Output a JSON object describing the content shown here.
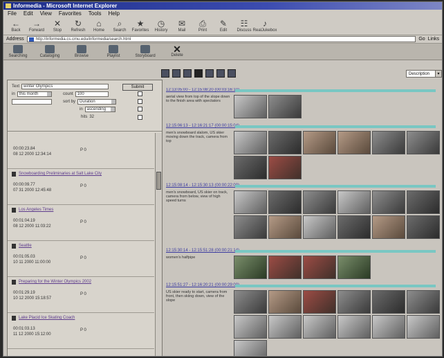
{
  "window": {
    "title": "Informedia - Microsoft Internet Explorer"
  },
  "menu": [
    "File",
    "Edit",
    "View",
    "Favorites",
    "Tools",
    "Help"
  ],
  "toolbar": [
    "Back",
    "Forward",
    "Stop",
    "Refresh",
    "Home",
    "Search",
    "Favorites",
    "History",
    "Mail",
    "Print",
    "Edit",
    "Discuss",
    "RealJukebox"
  ],
  "address": {
    "label": "Address",
    "url": "http://informedia.cs.cmu.edu/informedia/search.html",
    "go": "Go",
    "links": "Links"
  },
  "apptools": [
    "Searching",
    "Cataloging",
    "Browse",
    "Playlist",
    "Storyboard",
    "Delete"
  ],
  "view": {
    "mode": "Description"
  },
  "search": {
    "text_label": "Text",
    "text_value": "winter Olympics",
    "submit": "Submit",
    "in_label": "in",
    "in_value": "this month",
    "count_label": "count",
    "count_value": "100",
    "sort_label": "sort by",
    "sort_value": "Duration",
    "order_label": "in",
    "order_value": "ascending",
    "results_label": "hits",
    "results_value": "32"
  },
  "results": [
    {
      "title": "",
      "d1": "00:00:23.84",
      "d2": "08 12 2000 12:34:14",
      "meta": "P 0"
    },
    {
      "title": "Snowboarding Preliminaries at Salt Lake City",
      "d1": "00:00:09.77",
      "d2": "07 31 2000 12:45:48",
      "meta": "P 0"
    },
    {
      "title": "Los Angeles Times",
      "d1": "00:01:04.19",
      "d2": "08 12 2000 11:03:22",
      "meta": "P 0"
    },
    {
      "title": "Seattle",
      "d1": "00:01:05.03",
      "d2": "10 11 2000 11:00:00",
      "meta": "P 0"
    },
    {
      "title": "Preparing for the Winter Olympics 2002",
      "d1": "00:01:29.19",
      "d2": "10 12 2000 15:18:57",
      "meta": "P 0"
    },
    {
      "title": "Lake Placid Ice Skating Coach",
      "d1": "00:01:03.13",
      "d2": "11 12 2000 15:12:00",
      "meta": "P 0"
    }
  ],
  "segments": [
    {
      "header": "12:13:05:00 - 12:15:08:20 (00:03:16:10)",
      "desc": "aerial view from top of the slope down to the finish area with spectators",
      "thumbs": 2
    },
    {
      "header": "12:15:06:13 - 12:16:21:17 (00:00:15:04)",
      "desc": "men's snowboard slalom, US skier moving down the track, camera from top",
      "thumbs": 8
    },
    {
      "header": "12:15:08:14 - 12:15:30:13 (00:00:22:00)",
      "desc": "men's snowboard, US skier on track, camera from below, view of high speed turns",
      "thumbs": 12
    },
    {
      "header": "12:15:30:14 - 12:15:51:28 (00:00:21:14)",
      "desc": "women's halfpipe",
      "thumbs": 4
    },
    {
      "header": "12:15:51:27 - 12:16:20:21 (00:00:29:00)",
      "desc": "US skier ready to start, camera from front, then skiing down, view of the slope",
      "thumbs": 13
    }
  ]
}
